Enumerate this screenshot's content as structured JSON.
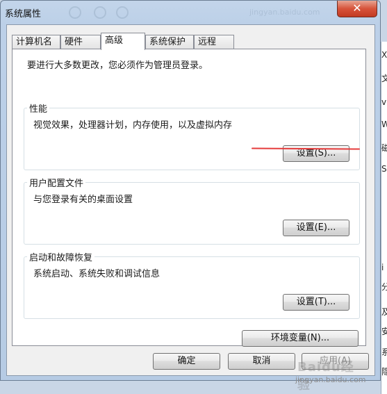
{
  "window": {
    "title": "系统属性",
    "close_glyph": "✕",
    "ghost_url": "jingyan.baidu.com"
  },
  "tabs": [
    {
      "label": "计算机名",
      "active": false
    },
    {
      "label": "硬件",
      "active": false
    },
    {
      "label": "高级",
      "active": true
    },
    {
      "label": "系统保护",
      "active": false
    },
    {
      "label": "远程",
      "active": false
    }
  ],
  "panel": {
    "intro": "要进行大多数更改，您必须作为管理员登录。",
    "performance": {
      "title": "性能",
      "description": "视觉效果，处理器计划，内存使用，以及虚拟内存",
      "button": "设置(S)..."
    },
    "user_profiles": {
      "title": "用户配置文件",
      "description": "与您登录有关的桌面设置",
      "button": "设置(E)..."
    },
    "startup_recovery": {
      "title": "启动和故障恢复",
      "description": "系统启动、系统失败和调试信息",
      "button": "设置(T)..."
    },
    "env_button": "环境变量(N)..."
  },
  "footer": {
    "ok": "确定",
    "cancel": "取消",
    "apply": "应用(A)"
  },
  "watermark": {
    "badge": "Baidu经验",
    "url": "jingyan.baidu.com"
  },
  "background_chars": [
    "X",
    "文",
    "v",
    "W",
    "磁",
    "S",
    "i",
    "分",
    "及",
    "安",
    "系",
    "隐"
  ],
  "colors": {
    "annotation_line": "#e53b3b",
    "close_button": "#c23a22"
  }
}
